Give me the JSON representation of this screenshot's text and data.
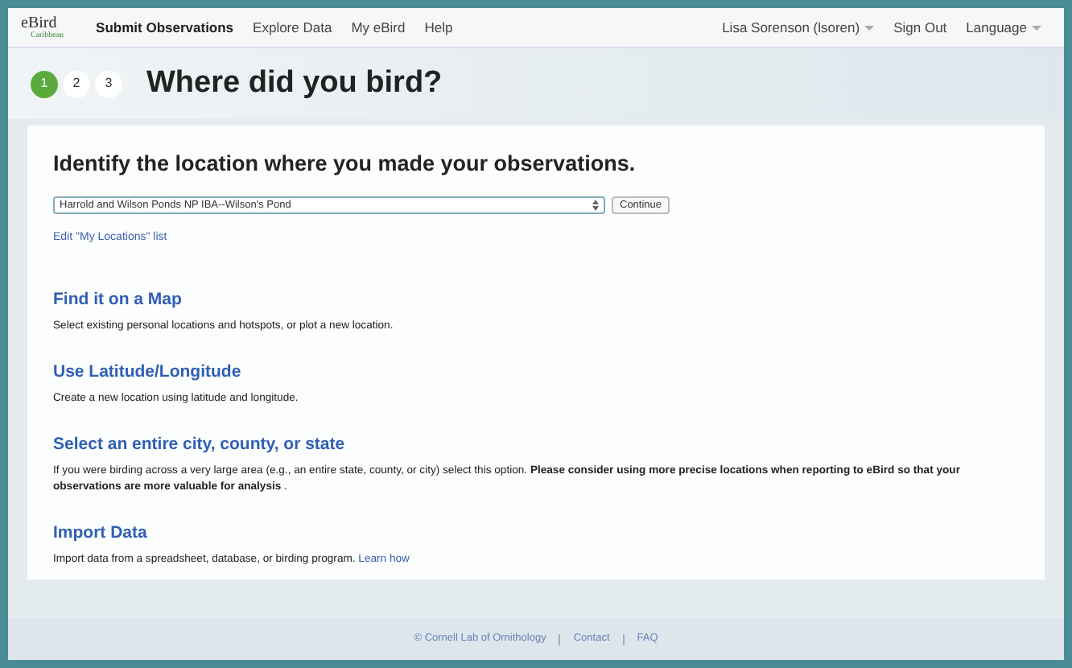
{
  "logo": {
    "name": "eBird",
    "region": "Caribbean"
  },
  "nav": [
    {
      "label": "Submit Observations",
      "selected": true
    },
    {
      "label": "Explore Data",
      "selected": false
    },
    {
      "label": "My eBird",
      "selected": false
    },
    {
      "label": "Help",
      "selected": false
    }
  ],
  "user_menu": [
    {
      "label": "Lisa Sorenson (lsoren)",
      "dropdown": true
    },
    {
      "label": "Sign Out",
      "dropdown": false
    },
    {
      "label": "Language",
      "dropdown": true
    }
  ],
  "steps": [
    {
      "label": "1",
      "selected": true
    },
    {
      "label": "2",
      "selected": false
    },
    {
      "label": "3",
      "selected": false
    }
  ],
  "page_title": "Where did you bird?",
  "heading": "Identify the location where you made your observations.",
  "location_select": {
    "value": "Harrold and Wilson Ponds NP IBA--Wilson's Pond"
  },
  "continue_button": "Continue",
  "edit_link": "Edit \"My Locations\" list",
  "options": [
    {
      "title": "Find it on a Map",
      "description": "Select existing personal locations and hotspots, or plot a new location."
    },
    {
      "title": "Use Latitude/Longitude",
      "description": "Create a new location using latitude and longitude."
    },
    {
      "title": "Select an entire city, county, or state",
      "description": "If you were birding across a very large area (e.g., an entire state, county, or city) select this option. **Please consider using more precise locations when reporting to eBird so that your observations are more valuable for analysis** ."
    },
    {
      "title": "Import Data",
      "description": "Import data from a spreadsheet, database, or birding program.",
      "link": "Learn how"
    }
  ],
  "footer": [
    "© Cornell Lab of Ornithology",
    "Contact",
    "FAQ"
  ]
}
